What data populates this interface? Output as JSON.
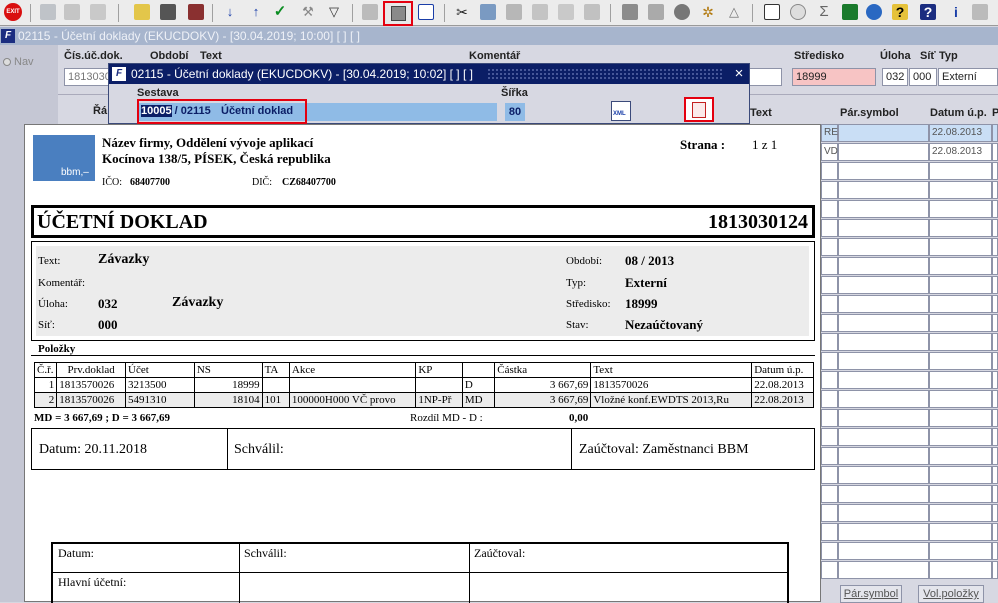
{
  "toolbar": {
    "exit_label": "EXIT"
  },
  "window": {
    "title": "02115 - Účetní doklady (EKUCDOKV) - [30.04.2019; 10:00]  [ ]  [ ]"
  },
  "left_panel": {
    "nav_label": "Nav"
  },
  "form": {
    "headers": {
      "doc_no": "Čís.úč.dok.",
      "period": "Období",
      "text": "Text",
      "comment": "Komentář",
      "center": "Středisko",
      "task": "Úloha",
      "net": "Síť",
      "type": "Typ"
    },
    "doc_no_value": "1813030",
    "center_value": "18999",
    "task_value": "032",
    "net_value": "000",
    "type_value": "Externí"
  },
  "grid": {
    "row_label": "Řá",
    "col_text": "Text",
    "col_par_symbol": "Pár.symbol",
    "col_date": "Datum ú.p.",
    "col_p": "P",
    "rows": [
      {
        "left": "RES",
        "date": "22.08.2013"
      },
      {
        "left": "VD",
        "date": "22.08.2013"
      }
    ],
    "btn_par_symbol": "Pár.symbol",
    "btn_vol_items": "Vol.položky"
  },
  "dialog": {
    "title": "02115 - Účetní doklady (EKUCDOKV) - [30.04.2019; 10:02]  [ ]  [ ]",
    "close": "×",
    "sestava_label": "Sestava",
    "sirka_label": "Šířka",
    "sestava_code": "10005",
    "sestava_suffix": " / 02115",
    "sestava_name": "Účetní doklad",
    "sirka_value": "80",
    "xml_label": "XML"
  },
  "report": {
    "logo_text": "bbm,–",
    "company": "Název firmy, Oddělení vývoje aplikací",
    "address": "Kocínova 138/5, PÍSEK, Česká republika",
    "ico_label": "IČO:",
    "ico_value": "68407700",
    "dic_label": "DIČ:",
    "dic_value": "CZ68407700",
    "page_label": "Strana  :",
    "page_value": "1  z  1",
    "doc_title": "ÚČETNÍ DOKLAD",
    "doc_number": "1813030124",
    "text_label": "Text:",
    "text_value": "Závazky",
    "comment_label": "Komentář:",
    "task_label": "Úloha:",
    "task_value": "032",
    "task_name": "Závazky",
    "net_label": "Síť:",
    "net_value": "000",
    "period_label": "Období:",
    "period_value": "08 / 2013",
    "type_label": "Typ:",
    "type_value": "Externí",
    "center_label": "Středisko:",
    "center_value": "18999",
    "state_label": "Stav:",
    "state_value": "Nezaúčtovaný",
    "items_title": "Položky",
    "columns": [
      "Č.ř.",
      "Prv.doklad",
      "Účet",
      "NS",
      "TA",
      "Akce",
      "KP",
      "",
      "Částka",
      "Text",
      "Datum ú.p."
    ],
    "rows": [
      [
        "1",
        "1813570026",
        "3213500",
        "18999",
        "",
        "",
        "",
        "D",
        "3 667,69",
        "1813570026",
        "22.08.2013"
      ],
      [
        "2",
        "1813570026",
        "5491310",
        "18104",
        "101",
        "100000H000 VČ provo",
        "1NP-Př",
        "MD",
        "3 667,69",
        "Vložné konf.EWDTS 2013,Ru",
        "22.08.2013"
      ]
    ],
    "totals": "MD = 3 667,69   ;  D = 3 667,69",
    "diff_label": "Rozdíl MD - D   :",
    "diff_value": "0,00",
    "sign_date": "Datum: 20.11.2018",
    "sign_approved": "Schválil:",
    "sign_booked": "Zaúčtoval: Zaměstnanci BBM",
    "footer_date": "Datum:",
    "footer_approved": "Schválil:",
    "footer_booked": "Zaúčtoval:",
    "footer_chief": "Hlavní účetní:"
  }
}
